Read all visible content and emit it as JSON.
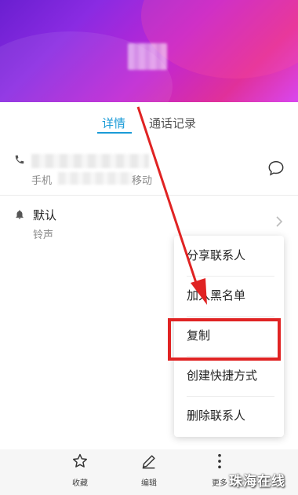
{
  "tabs": {
    "details": "详情",
    "call_log": "通话记录"
  },
  "contact": {
    "phone_type": "手机",
    "carrier_suffix": "移动",
    "ringtone_value": "默认",
    "ringtone_label": "铃声"
  },
  "menu": {
    "items": [
      "分享联系人",
      "加入黑名单",
      "复制",
      "创建快捷方式",
      "删除联系人"
    ],
    "highlighted": "复制"
  },
  "bottom_bar": {
    "favorite": "收藏",
    "edit": "编辑",
    "more": "更多"
  },
  "watermark": "珠海在线",
  "colors": {
    "accent": "#1a9bd7",
    "highlight_border": "#e02323",
    "header_gradient": [
      "#6a1fd0",
      "#c026d3",
      "#e0309a"
    ]
  },
  "icons": {
    "phone": "phone-icon",
    "bell": "bell-icon",
    "message": "message-bubble-icon",
    "chevron": "chevron-right-icon",
    "favorite": "star-icon",
    "edit": "pencil-icon",
    "more": "more-vertical-icon"
  }
}
